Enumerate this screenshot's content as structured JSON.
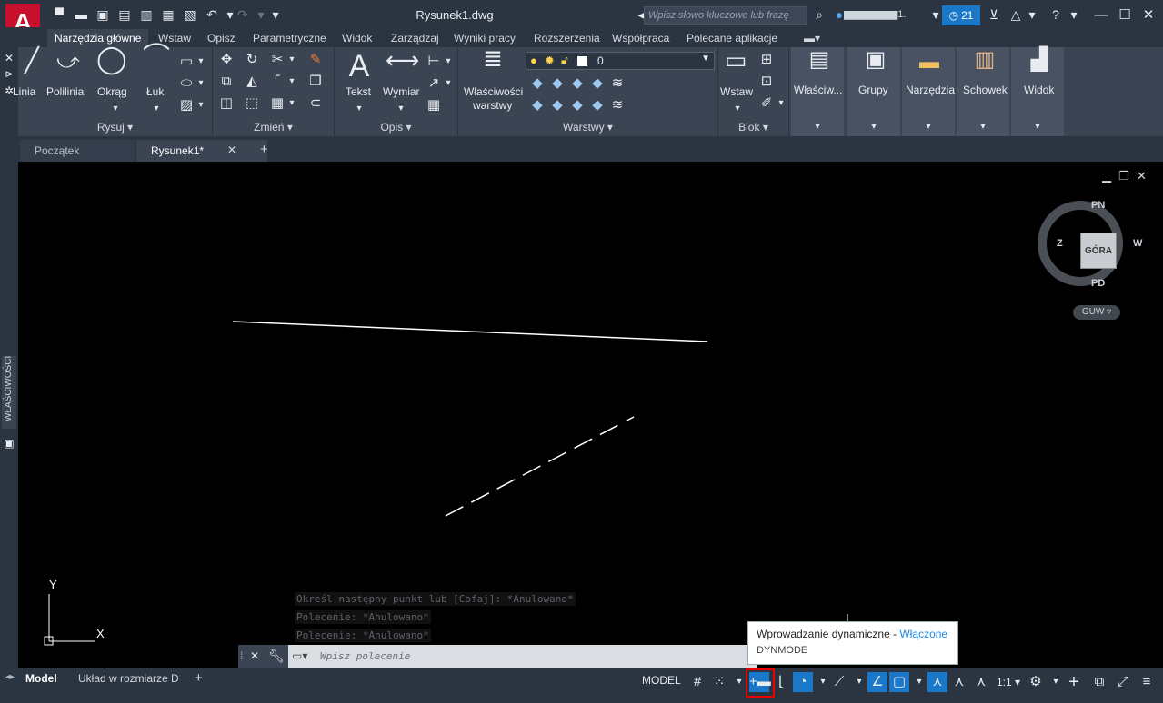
{
  "titlebar": {
    "document_title": "Rysunek1.dwg",
    "search_placeholder": "Wpisz słowo kluczowe lub frazę",
    "user_name": "▆▆▆▆▆▆▆1.",
    "notification_count": "21"
  },
  "ribbon_tabs": [
    "Narzędzia główne",
    "Wstaw",
    "Opisz",
    "Parametryczne",
    "Widok",
    "Zarządzaj",
    "Wyniki pracy",
    "Rozszerzenia",
    "Współpraca",
    "Polecane aplikacje"
  ],
  "ribbon": {
    "draw": {
      "title": "Rysuj",
      "line": "Linia",
      "polyline": "Polilinia",
      "circle": "Okrąg",
      "arc": "Łuk"
    },
    "modify": {
      "title": "Zmień"
    },
    "annotation": {
      "title": "Opis",
      "text": "Tekst",
      "dimension": "Wymiar"
    },
    "layers": {
      "title": "Warstwy",
      "layer_props_1": "Właściwości",
      "layer_props_2": "warstwy",
      "current_layer": "0"
    },
    "block": {
      "title": "Blok",
      "insert": "Wstaw"
    },
    "properties": "Właściw...",
    "groups": "Grupy",
    "utilities": "Narzędzia",
    "clipboard": "Schowek",
    "view": "Widok"
  },
  "left_palette": {
    "label": "WŁAŚCIWOŚCI"
  },
  "file_tabs": [
    "Początek",
    "Rysunek1*"
  ],
  "viewcube": {
    "face": "GÓRA",
    "north": "PN",
    "south": "PD",
    "east": "W",
    "west": "Z",
    "ucs": "GUW"
  },
  "ucs_icon": {
    "x": "X",
    "y": "Y"
  },
  "command_history": [
    "Określ następny punkt lub [Cofaj]: *Anulowano*",
    "Polecenie: *Anulowano*",
    "Polecenie: *Anulowano*"
  ],
  "command_line": {
    "placeholder": "Wpisz polecenie"
  },
  "tooltip": {
    "title": "Wprowadzanie dynamiczne - ",
    "state": "Włączone",
    "command": "DYNMODE"
  },
  "status_bar": {
    "layout_tabs": [
      "Model",
      "Układ w rozmiarze D"
    ],
    "model_label": "MODEL",
    "scale": "1:1"
  },
  "colors": {
    "accent": "#1b78c8",
    "brand": "#c8102e",
    "highlight_box": "#e00000"
  }
}
